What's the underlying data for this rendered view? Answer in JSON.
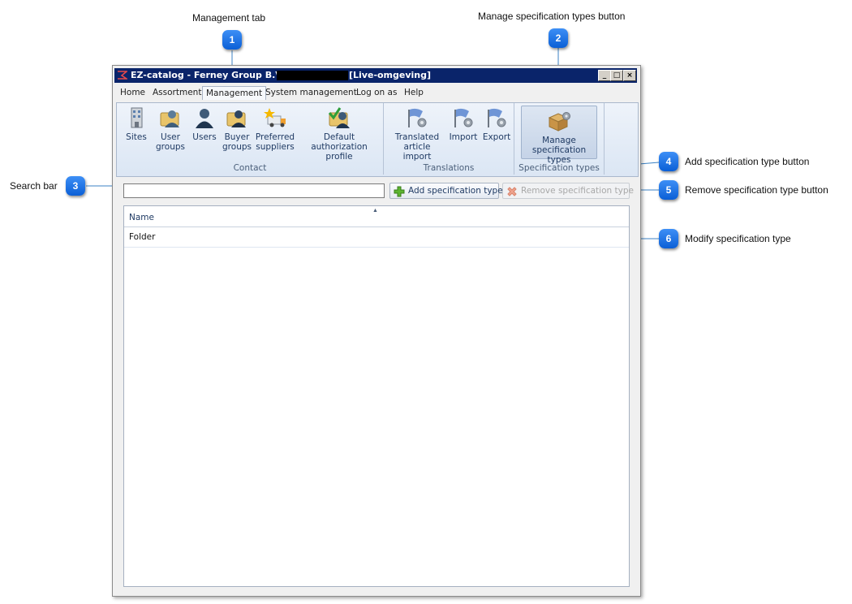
{
  "callouts": [
    {
      "number": "1",
      "label": "Management tab"
    },
    {
      "number": "2",
      "label": "Manage specification types button"
    },
    {
      "number": "3",
      "label": "Search bar"
    },
    {
      "number": "4",
      "label": "Add specification type button"
    },
    {
      "number": "5",
      "label": "Remove specification type button"
    },
    {
      "number": "6",
      "label": "Modify specification type"
    }
  ],
  "window": {
    "title": "EZ-catalog - Ferney Group B.V. -",
    "environment": "[Live-omgeving]",
    "controls": {
      "minimize": "_",
      "maximize": "□",
      "close": "×"
    }
  },
  "menu": {
    "items": [
      "Home",
      "Assortment",
      "Management",
      "System management",
      "Log on as",
      "Help"
    ],
    "active": "Management"
  },
  "ribbon": {
    "groups": [
      {
        "label": "Contact",
        "buttons": [
          {
            "line1": "Sites",
            "line2": "",
            "icon": "building-icon"
          },
          {
            "line1": "User",
            "line2": "groups",
            "icon": "user-groups-icon"
          },
          {
            "line1": "Users",
            "line2": "",
            "icon": "users-icon"
          },
          {
            "line1": "Buyer",
            "line2": "groups",
            "icon": "buyer-groups-icon"
          },
          {
            "line1": "Preferred",
            "line2": "suppliers",
            "icon": "truck-star-icon"
          },
          {
            "line1": "Default",
            "line2": "authorization profile",
            "icon": "authorization-icon"
          }
        ]
      },
      {
        "label": "Translations",
        "buttons": [
          {
            "line1": "Translated",
            "line2": "article import",
            "icon": "flag-gear-icon"
          },
          {
            "line1": "Import",
            "line2": "",
            "icon": "flag-gear-icon"
          },
          {
            "line1": "Export",
            "line2": "",
            "icon": "flag-gear-icon"
          }
        ]
      },
      {
        "label": "Specification types",
        "buttons": [
          {
            "line1": "Manage",
            "line2": "specification types",
            "icon": "box-gear-icon"
          }
        ]
      }
    ]
  },
  "toolbar": {
    "search_placeholder": "",
    "search_value": "",
    "add_label": "Add specification type",
    "remove_label": "Remove specification type"
  },
  "grid": {
    "columns": [
      "Name"
    ],
    "rows": [
      [
        "Folder"
      ]
    ]
  },
  "colors": {
    "titlebar": "#0a246a",
    "callout_marker": "#1a73e8",
    "ribbon_bg": "#dbe6f4"
  }
}
